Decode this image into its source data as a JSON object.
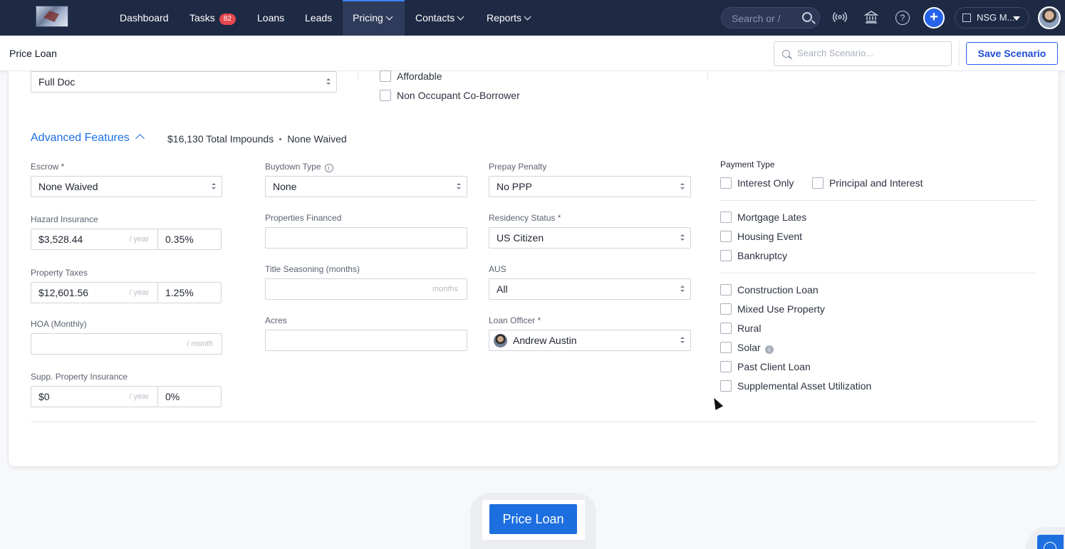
{
  "nav": {
    "items": [
      {
        "label": "Dashboard"
      },
      {
        "label": "Tasks",
        "badge": "82"
      },
      {
        "label": "Loans"
      },
      {
        "label": "Leads"
      },
      {
        "label": "Pricing",
        "active": true
      },
      {
        "label": "Contacts"
      },
      {
        "label": "Reports"
      }
    ],
    "search_placeholder": "Search or /",
    "org_label": "NSG M...",
    "icons": [
      "broadcast-icon",
      "bank-icon",
      "help-icon",
      "plus-icon"
    ],
    "help_glyph": "?"
  },
  "subheader": {
    "title": "Price Loan",
    "search_placeholder": "Search Scenario...",
    "save_label": "Save Scenario"
  },
  "top_section": {
    "doc_type_value": "Full Doc",
    "checkboxes": [
      "Affordable",
      "Non Occupant Co-Borrower"
    ]
  },
  "advanced": {
    "title": "Advanced Features",
    "total_impounds": "$16,130 Total Impounds",
    "waived": "None Waived"
  },
  "col1": {
    "escrow": {
      "label": "Escrow *",
      "value": "None Waived"
    },
    "hazard": {
      "label": "Hazard Insurance",
      "amount": "$3,528.44",
      "suffix": "/ year",
      "percent": "0.35%"
    },
    "taxes": {
      "label": "Property Taxes",
      "amount": "$12,601.56",
      "suffix": "/ year",
      "percent": "1.25%"
    },
    "hoa": {
      "label": "HOA (Monthly)",
      "amount": "",
      "suffix": "/ month"
    },
    "supp": {
      "label": "Supp. Property Insurance",
      "amount": "$0",
      "suffix": "/ year",
      "percent": "0%"
    }
  },
  "col2": {
    "buydown": {
      "label": "Buydown Type",
      "value": "None"
    },
    "properties_financed": {
      "label": "Properties Financed",
      "value": ""
    },
    "title_seasoning": {
      "label": "Title Seasoning (months)",
      "value": "",
      "suffix": "months"
    },
    "acres": {
      "label": "Acres",
      "value": ""
    }
  },
  "col3": {
    "prepay": {
      "label": "Prepay Penalty",
      "value": "No PPP"
    },
    "residency": {
      "label": "Residency Status *",
      "value": "US Citizen"
    },
    "aus": {
      "label": "AUS",
      "value": "All"
    },
    "loan_officer": {
      "label": "Loan Officer *",
      "value": "Andrew Austin"
    }
  },
  "col4": {
    "payment_type_label": "Payment Type",
    "payment_types": [
      "Interest Only",
      "Principal and Interest"
    ],
    "group1": [
      "Mortgage Lates",
      "Housing Event",
      "Bankruptcy"
    ],
    "group2": [
      "Construction Loan",
      "Mixed Use Property",
      "Rural",
      "Solar",
      "Past Client Loan",
      "Supplemental Asset Utilization"
    ],
    "info_glyph": "i"
  },
  "footer": {
    "price_button": "Price Loan"
  },
  "colors": {
    "nav_bg": "#1e2a44",
    "accent": "#1d6fe0",
    "badge": "#e5484d"
  }
}
